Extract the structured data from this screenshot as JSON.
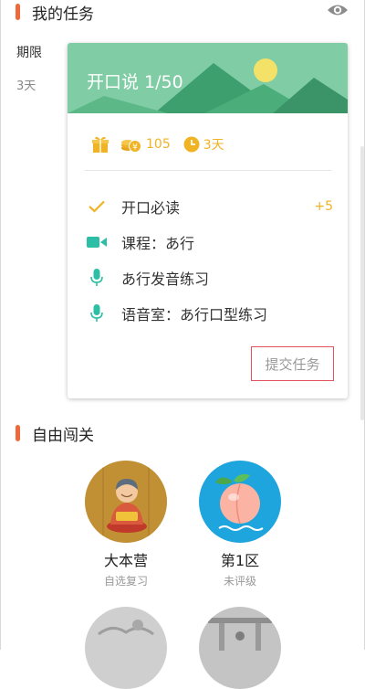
{
  "my_tasks": {
    "title": "我的任务",
    "period_label": "期限",
    "period_value": "3天"
  },
  "card": {
    "title": "开口说 1/50",
    "rewards": {
      "coins": "105",
      "time": "3天"
    },
    "tasks": [
      {
        "label": "开口必读",
        "points": "+5",
        "icon": "check-icon"
      },
      {
        "label": "课程：あ行",
        "icon": "video-camera-icon"
      },
      {
        "label": "あ行发音练习",
        "icon": "microphone-icon"
      },
      {
        "label": "语音室：あ行口型练习",
        "icon": "microphone-icon"
      }
    ],
    "submit_label": "提交任务"
  },
  "free_levels": {
    "title": "自由闯关",
    "levels": [
      {
        "name": "大本营",
        "subtitle": "自选复习"
      },
      {
        "name": "第1区",
        "subtitle": "未评级"
      }
    ]
  },
  "colors": {
    "accent": "#ee6a3c",
    "banner_green": "#7fcca5",
    "reward_gold": "#f0b323",
    "task_teal": "#2dbfa5",
    "submit_border": "#e2535f"
  }
}
